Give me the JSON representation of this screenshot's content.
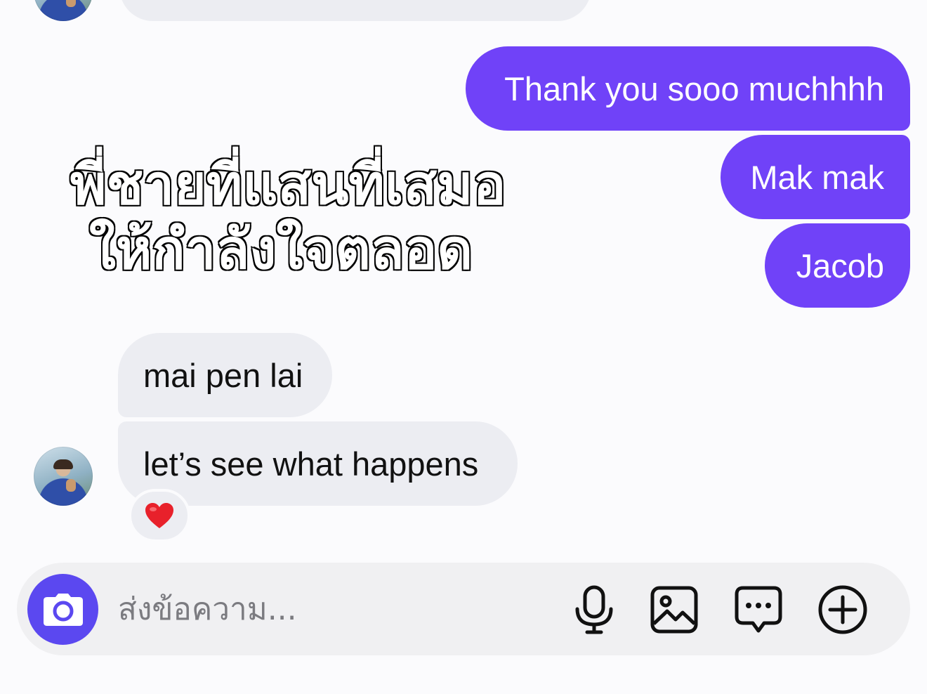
{
  "overlay_caption": {
    "line1": "พี่ชายที่แสนที่เสมอ",
    "line2": "ให้กำลังใจตลอด"
  },
  "messages": {
    "sent": [
      {
        "text": "Thank you sooo muchhhh"
      },
      {
        "text": "Mak mak"
      },
      {
        "text": "Jacob"
      }
    ],
    "received": [
      {
        "text": "mai pen lai"
      },
      {
        "text": "let’s see what happens"
      }
    ],
    "reaction": {
      "emoji": "heart",
      "color": "#e8212b"
    }
  },
  "composer": {
    "placeholder": "ส่งข้อความ...",
    "buttons": {
      "camera": "camera-icon",
      "voice": "microphone-icon",
      "gallery": "image-icon",
      "sticker": "chat-bubble-icon",
      "more": "plus-icon"
    }
  },
  "colors": {
    "sent_bubble": "#7042f8",
    "received_bubble": "#ecedf2",
    "camera_button": "#5b48f0",
    "background": "#fbfbfd"
  }
}
